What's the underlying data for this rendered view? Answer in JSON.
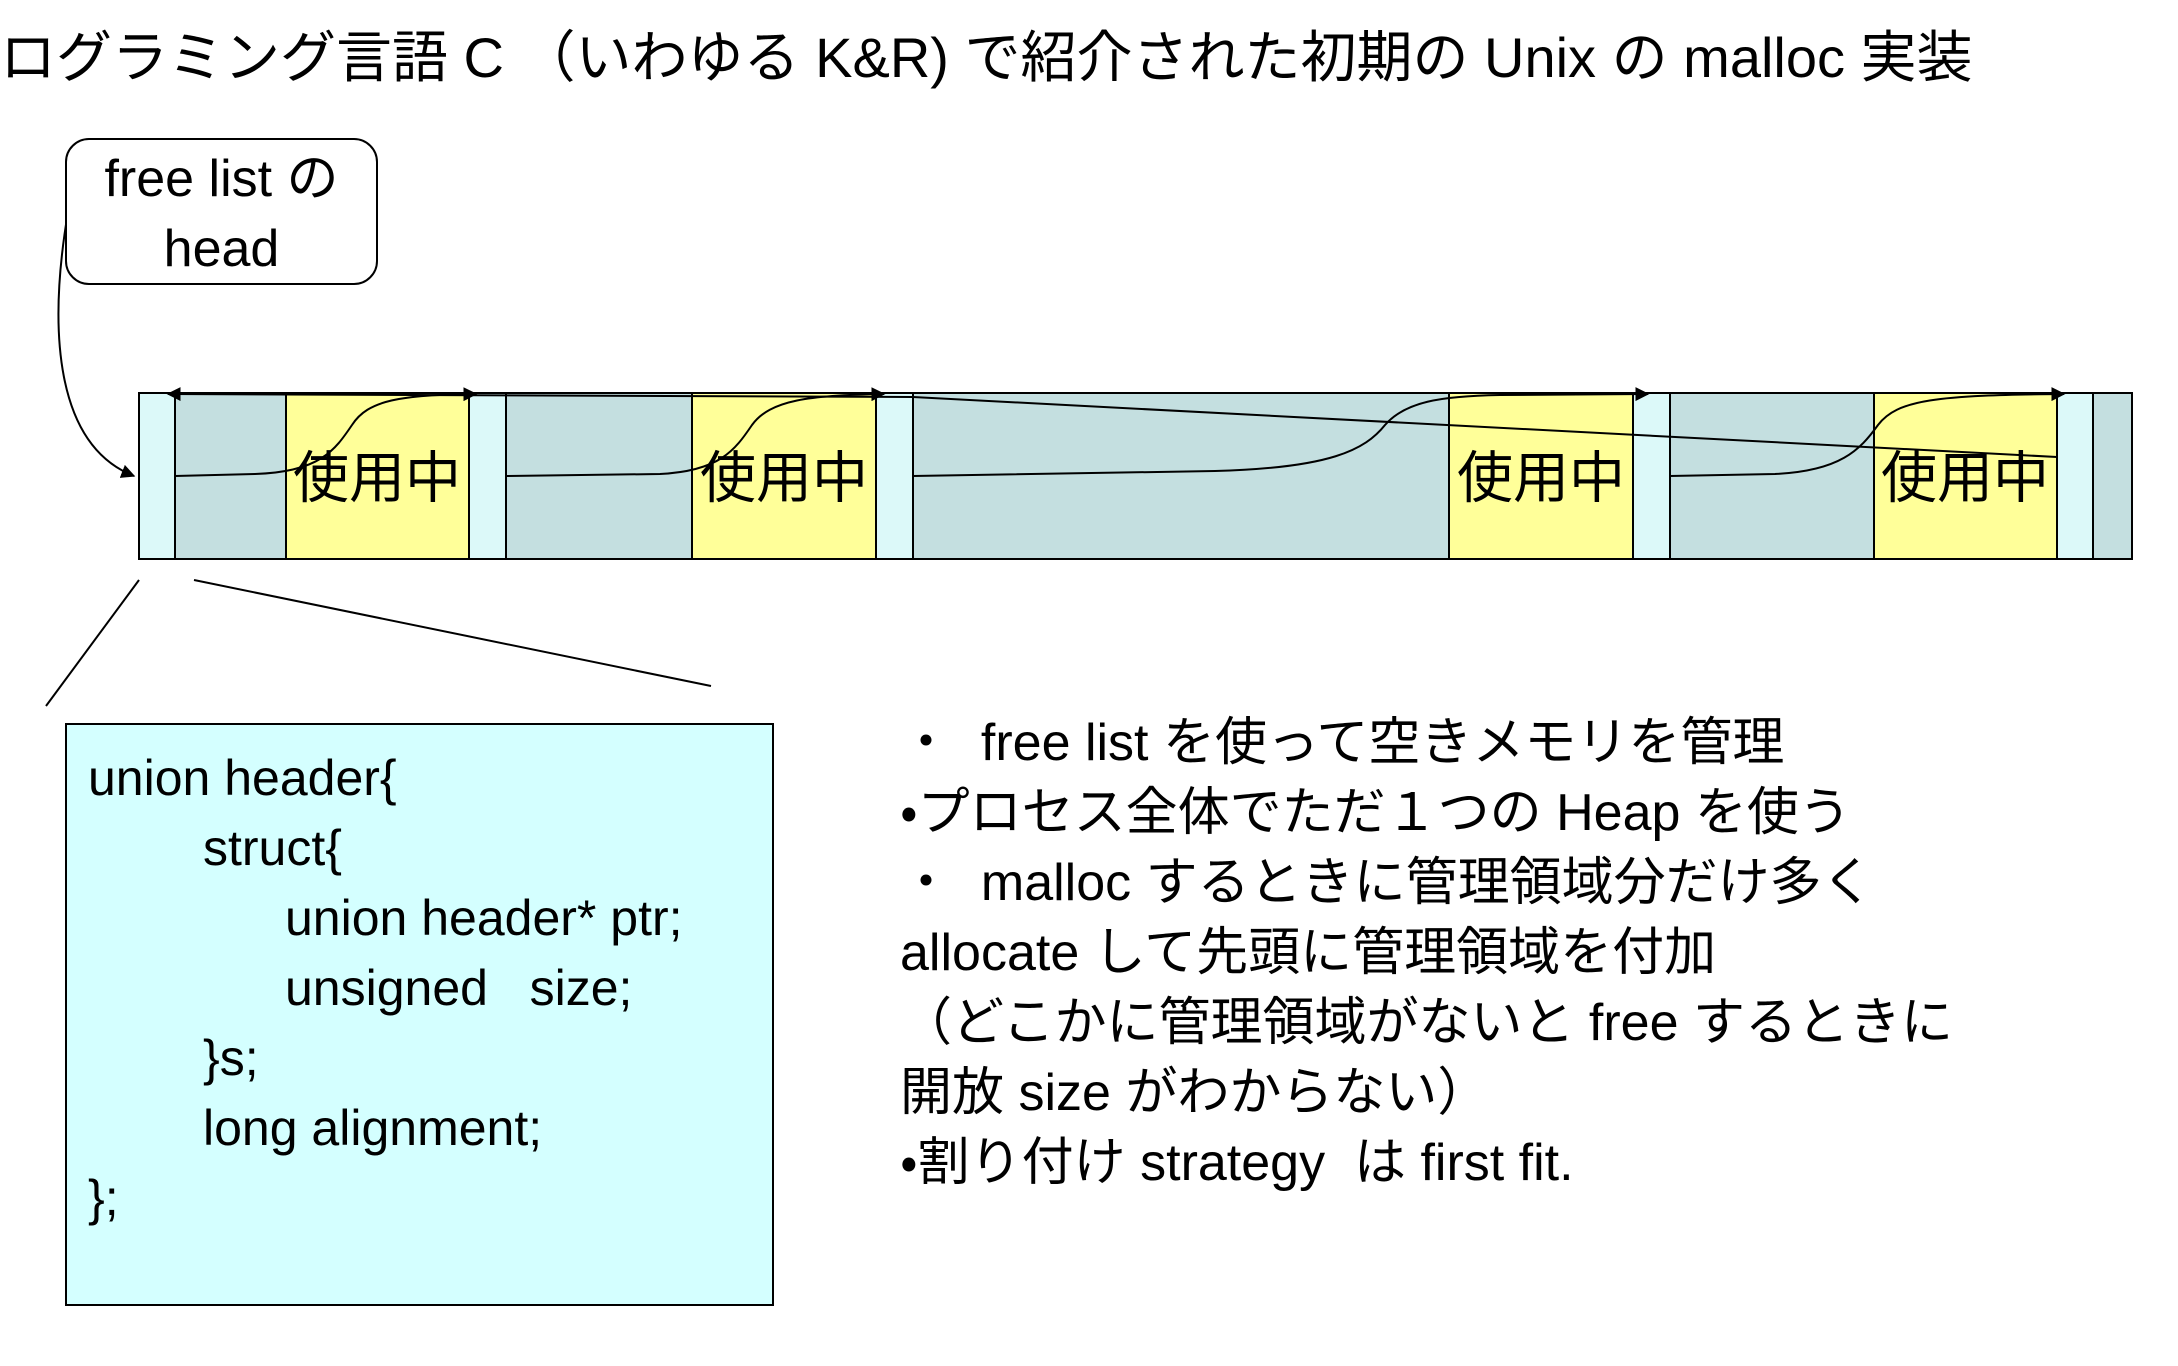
{
  "title": "ログラミング言語 C （いわゆる K&R) で紹介された初期の Unix の malloc 実装",
  "callout": {
    "line1": "free list の",
    "line2": "head"
  },
  "memory_bar": {
    "used_blocks": [
      {
        "label": "使用中"
      },
      {
        "label": "使用中"
      },
      {
        "label": "使用中"
      },
      {
        "label": "使用中"
      }
    ]
  },
  "code": {
    "lines": [
      "union header{",
      "struct{",
      "union header* ptr;",
      "unsigned   size;",
      "}s;",
      "long alignment;",
      "};"
    ]
  },
  "notes": {
    "lines": [
      "・  free list を使って空きメモリを管理",
      "・プロセス全体でただ１つの Heap を使う",
      "・  malloc するときに管理領域分だけ多く",
      "allocate して先頭に管理領域を付加",
      "（どこかに管理領域がないと free するときに",
      "開放 size がわからない）",
      "・割り付け strategy  は first fit."
    ]
  },
  "colors": {
    "header_block": "#dcf9f9",
    "free_region": "#c4dfe0",
    "used_block": "#ffff99",
    "code_box": "#d4ffff",
    "line": "#000000"
  }
}
